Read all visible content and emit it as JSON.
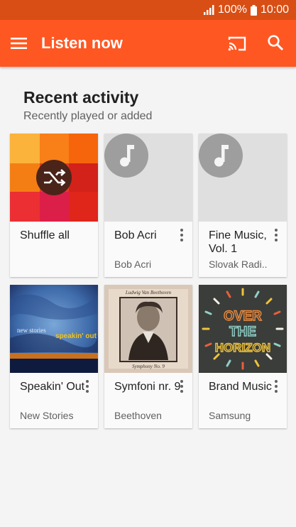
{
  "status_bar": {
    "battery": "100%",
    "time": "10:00"
  },
  "app_bar": {
    "title": "Listen now"
  },
  "section": {
    "title": "Recent activity",
    "subtitle": "Recently played or added"
  },
  "cards": [
    {
      "name": "Shuffle all",
      "sub": ""
    },
    {
      "name": "Bob Acri",
      "sub": "Bob Acri"
    },
    {
      "name": "Fine Music, Vol. 1",
      "sub": "Slovak Radi.."
    },
    {
      "name": "Speakin' Out",
      "sub": "New Stories",
      "art_title": "new stories",
      "art_word": "speakin' out"
    },
    {
      "name": "Symfoni nr. 9",
      "sub": "Beethoven",
      "art_top": "Ludwig Van Beethoven",
      "art_bottom": "Symphony No. 9"
    },
    {
      "name": "Brand Music",
      "sub": "Samsung",
      "art_lines": [
        "OVER",
        "THE",
        "HORIZON"
      ]
    }
  ],
  "colors": {
    "accent": "#ff5722",
    "status": "#d94e14"
  },
  "icons": [
    "signal-icon",
    "battery-icon",
    "menu-icon",
    "cast-icon",
    "search-icon",
    "shuffle-icon",
    "music-note-icon",
    "more-vert-icon"
  ]
}
